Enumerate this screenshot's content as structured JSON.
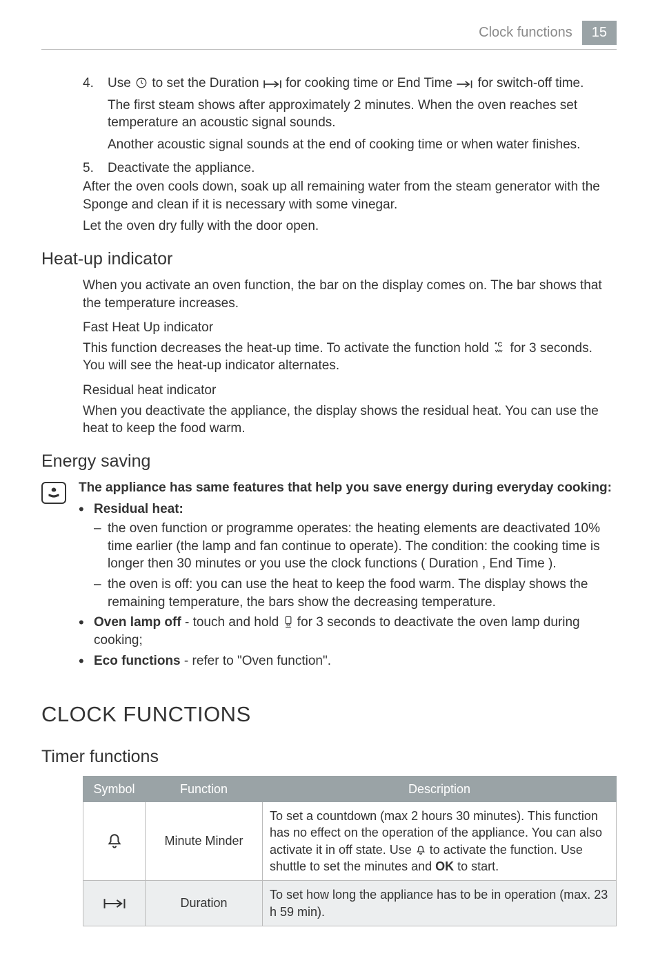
{
  "header": {
    "title": "Clock functions",
    "page": "15"
  },
  "steps": {
    "s4_num": "4.",
    "s4_a": "Use ",
    "s4_b": " to set the Duration ",
    "s4_c": " for cooking time or End Time ",
    "s4_d": " for switch-off time.",
    "s4_p1": "The first steam shows after approximately 2 minutes. When the oven reaches set temperature an acoustic signal sounds.",
    "s4_p2": "Another acoustic signal sounds at the end of cooking time or when water finishes.",
    "s5_num": "5.",
    "s5_text": "Deactivate the appliance.",
    "after1": "After the oven cools down, soak up all remaining water from the steam generator with the Sponge and clean if it is necessary with some vinegar.",
    "after2": "Let the oven dry fully with the door open."
  },
  "heatup": {
    "heading": "Heat-up indicator",
    "p1": "When you activate an oven function, the bar on the display comes on. The bar shows that the temperature increases.",
    "sub1": "Fast Heat Up indicator",
    "p2a": "This function decreases the heat-up time. To activate the function hold ",
    "p2b": " for 3 seconds. You will see the heat-up indicator alternates.",
    "sub2": "Residual heat indicator",
    "p3": "When you deactivate the appliance, the display shows the residual heat. You can use the heat to keep the food warm."
  },
  "energy": {
    "heading": "Energy saving",
    "intro": "The appliance has same features that help you save energy during everyday cooking:",
    "b1_label": "Residual heat:",
    "b1_d1": "the oven function or programme operates: the heating elements are deactivated 10% time earlier (the lamp and fan continue to operate). The condition: the cooking time is longer then 30 minutes or you use the clock functions ( Duration , End Time ).",
    "b1_d2": "the oven is off: you can use the heat to keep the food warm. The display shows the remaining temperature, the bars show the decreasing temperature.",
    "b2_label": "Oven lamp off",
    "b2_a": " - touch and hold ",
    "b2_b": " for 3 seconds to deactivate the oven lamp during cooking;",
    "b3_label": "Eco functions",
    "b3_text": " - refer to \"Oven function\"."
  },
  "clock": {
    "heading": "CLOCK FUNCTIONS",
    "sub": "Timer functions",
    "th_symbol": "Symbol",
    "th_function": "Function",
    "th_description": "Description",
    "rows": [
      {
        "icon": "bell",
        "function": "Minute Minder",
        "desc_a": "To set a countdown (max 2 hours 30 minutes). This function has no effect on the operation of the appliance. You can also activate it in off state. Use ",
        "desc_b": " to activate the function. Use shuttle to set the minutes and ",
        "desc_ok": "OK",
        "desc_c": " to start."
      },
      {
        "icon": "duration",
        "function": "Duration",
        "desc": "To set how long the appliance has to be in operation (max. 23 h 59 min)."
      }
    ]
  }
}
